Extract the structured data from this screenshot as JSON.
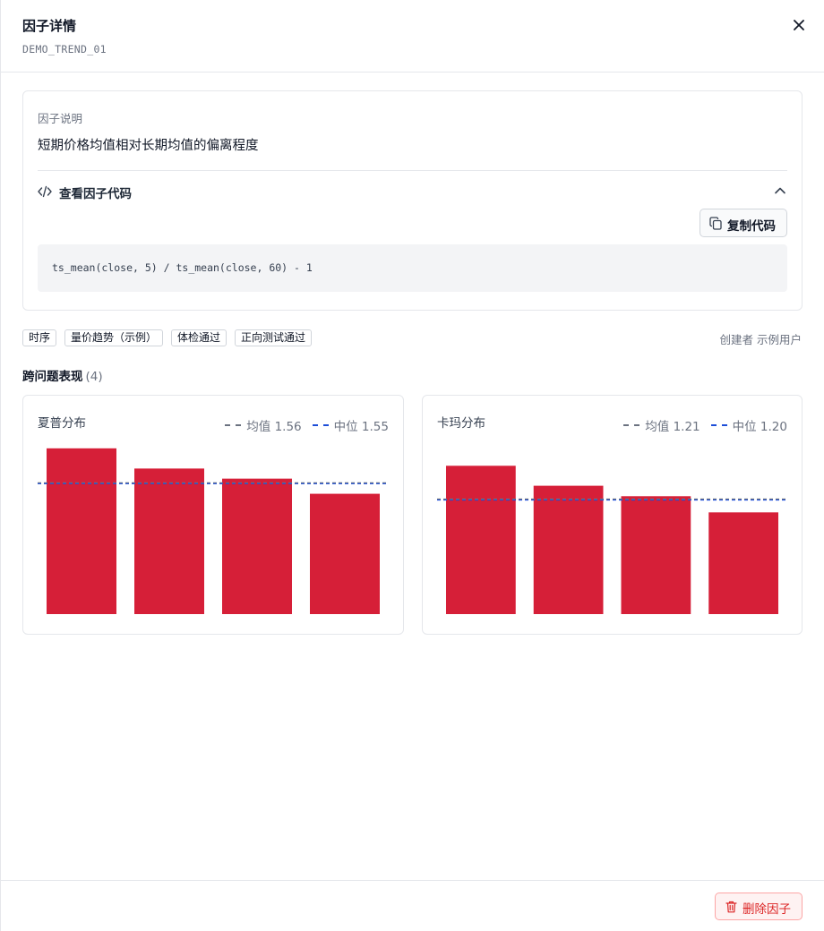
{
  "panel": {
    "title": "因子详情",
    "factor_id": "DEMO_TREND_01"
  },
  "description": {
    "label": "因子说明",
    "text": "短期价格均值相对长期均值的偏离程度",
    "code_toggle_label": "查看因子代码",
    "copy_button_label": "复制代码",
    "code": "ts_mean(close, 5) / ts_mean(close, 60) - 1"
  },
  "tags": [
    "时序",
    "量价趋势（示例）",
    "体检通过",
    "正向测试通过"
  ],
  "creator": "创建者 示例用户",
  "section": {
    "title": "跨问题表现",
    "count": "(4)"
  },
  "charts": [
    {
      "title": "夏普分布",
      "legend_mean": "均值 1.56",
      "legend_median": "中位 1.55"
    },
    {
      "title": "卡玛分布",
      "legend_mean": "均值 1.21",
      "legend_median": "中位 1.20"
    }
  ],
  "chart_data": [
    {
      "type": "bar",
      "title": "夏普分布",
      "values": [
        1.97,
        1.73,
        1.61,
        1.43
      ],
      "mean": 1.56,
      "median": 1.55,
      "ylim": [
        0,
        2.0
      ],
      "bar_color": "#d61f38",
      "mean_color": "#6b7280",
      "median_color": "#1d4ed8"
    },
    {
      "type": "bar",
      "title": "卡玛分布",
      "values": [
        1.56,
        1.35,
        1.24,
        1.07
      ],
      "mean": 1.21,
      "median": 1.2,
      "ylim": [
        0,
        1.77
      ],
      "bar_color": "#d61f38",
      "mean_color": "#6b7280",
      "median_color": "#1d4ed8"
    }
  ],
  "footer": {
    "delete_button_label": "删除因子"
  },
  "colors": {
    "accent_red": "#d61f38",
    "danger_text": "#dc2626",
    "border": "#e5e7eb"
  }
}
